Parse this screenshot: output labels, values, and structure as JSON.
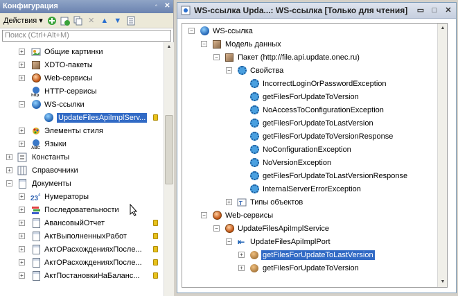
{
  "left_panel": {
    "title": "Конфигурация",
    "toolbar": {
      "actions_label": "Действия"
    },
    "search": {
      "placeholder": "Поиск (Ctrl+Alt+M)"
    },
    "tree": [
      {
        "label": "Общие картинки"
      },
      {
        "label": "XDTO-пакеты"
      },
      {
        "label": "Web-сервисы"
      },
      {
        "label": "HTTP-сервисы"
      },
      {
        "label": "WS-ссылки"
      },
      {
        "label": "UpdateFilesApiImplServ..."
      },
      {
        "label": "Элементы стиля"
      },
      {
        "label": "Языки"
      },
      {
        "label": "Константы"
      },
      {
        "label": "Справочники"
      },
      {
        "label": "Документы"
      },
      {
        "label": "Нумераторы"
      },
      {
        "label": "Последовательности"
      },
      {
        "label": "АвансовыйОтчет"
      },
      {
        "label": "АктВыполненныхРабот"
      },
      {
        "label": "АктОРасхожденияхПосле..."
      },
      {
        "label": "АктОРасхожденияхПосле..."
      },
      {
        "label": "АктПостановкиНаБаланс..."
      }
    ]
  },
  "right_window": {
    "title": "WS-ссылка Upda...: WS-ссылка [Только для чтения]",
    "tree": [
      {
        "label": "WS-ссылка"
      },
      {
        "label": "Модель данных"
      },
      {
        "label": "Пакет (http://file.api.update.onec.ru)"
      },
      {
        "label": "Свойства"
      },
      {
        "label": "IncorrectLoginOrPasswordException"
      },
      {
        "label": "getFilesForUpdateToVersion"
      },
      {
        "label": "NoAccessToConfigurationException"
      },
      {
        "label": "getFilesForUpdateToLastVersion"
      },
      {
        "label": "getFilesForUpdateToVersionResponse"
      },
      {
        "label": "NoConfigurationException"
      },
      {
        "label": "NoVersionException"
      },
      {
        "label": "getFilesForUpdateToLastVersionResponse"
      },
      {
        "label": "InternalServerErrorException"
      },
      {
        "label": "Типы объектов"
      },
      {
        "label": "Web-сервисы"
      },
      {
        "label": "UpdateFilesApiImplService"
      },
      {
        "label": "UpdateFilesApiImplPort"
      },
      {
        "label": "getFilesForUpdateToLastVersion"
      },
      {
        "label": "getFilesForUpdateToVersion"
      }
    ]
  },
  "icons": {
    "toolbar": [
      "add-icon",
      "add-icon",
      "copy-icon",
      "delete-icon",
      "move-up-icon",
      "move-down-icon",
      "list-icon"
    ]
  },
  "colors": {
    "selection": "#316ac5",
    "title_bar": "#6b83b0"
  }
}
